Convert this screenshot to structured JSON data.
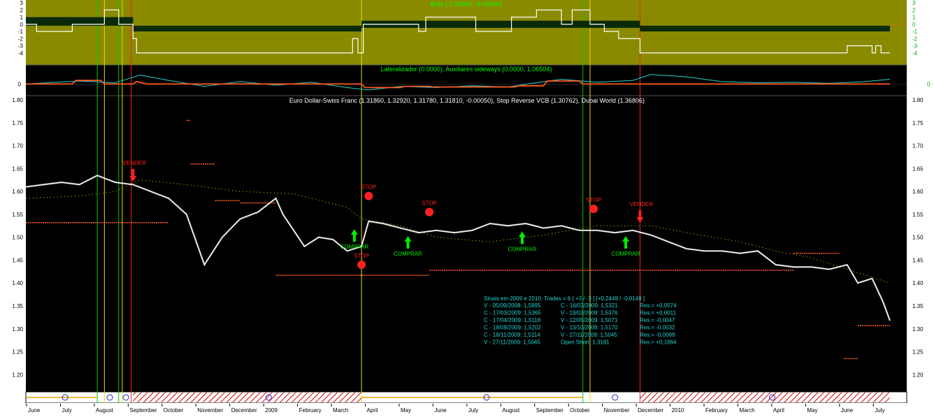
{
  "colors": {
    "indicator_bg": "#8a8a00",
    "panel_bg": "#000000",
    "price_line": "#ffffff",
    "stop_reverse": "#ff5a1f",
    "dubai_dots": "#e0e000",
    "buy_signal": "#00ee00",
    "sell_signal": "#ff2020",
    "stats_text": "#22d3d3",
    "title_green": "#00ff00",
    "axis_text": "#000000"
  },
  "chart_data": [
    {
      "type": "step",
      "title": "Bobi (-1.00000, -5.00000)",
      "ylim": [
        -5,
        3
      ],
      "yticks": [
        "3",
        "2",
        "1",
        "0",
        "-1",
        "-2",
        "-3",
        "-4"
      ],
      "series": [
        {
          "values": [
            {
              "t": 0,
              "v": 0
            },
            {
              "t": 0.3,
              "v": -1
            },
            {
              "t": 1.3,
              "v": 0
            },
            {
              "t": 2.0,
              "v": 0
            },
            {
              "t": 2.2,
              "v": 2
            },
            {
              "t": 2.6,
              "v": 0
            },
            {
              "t": 3.0,
              "v": -2
            },
            {
              "t": 3.1,
              "v": -4
            },
            {
              "t": 9.0,
              "v": -4
            },
            {
              "t": 9.15,
              "v": -2
            },
            {
              "t": 9.3,
              "v": -4
            },
            {
              "t": 9.45,
              "v": 0
            },
            {
              "t": 10.8,
              "v": 0
            },
            {
              "t": 11.0,
              "v": -1
            },
            {
              "t": 11.2,
              "v": 1
            },
            {
              "t": 12.5,
              "v": 1
            },
            {
              "t": 12.6,
              "v": -1
            },
            {
              "t": 13.4,
              "v": -1
            },
            {
              "t": 13.6,
              "v": 1
            },
            {
              "t": 14.3,
              "v": 2
            },
            {
              "t": 15.0,
              "v": 0
            },
            {
              "t": 15.3,
              "v": 2
            },
            {
              "t": 15.8,
              "v": 0
            },
            {
              "t": 16.2,
              "v": -1
            },
            {
              "t": 16.6,
              "v": -2
            },
            {
              "t": 17.0,
              "v": -2
            },
            {
              "t": 17.2,
              "v": -4
            },
            {
              "t": 22.8,
              "v": -4
            },
            {
              "t": 23.0,
              "v": -3
            },
            {
              "t": 23.6,
              "v": -3
            },
            {
              "t": 23.7,
              "v": -4
            },
            {
              "t": 23.8,
              "v": -3
            },
            {
              "t": 23.95,
              "v": -4
            },
            {
              "t": 24.2,
              "v": -4
            }
          ]
        }
      ],
      "band": [
        {
          "t0": 0.0,
          "t1": 3.0,
          "lo": -0.2,
          "hi": 1.0
        },
        {
          "t0": 3.0,
          "t1": 9.4,
          "lo": -1.0,
          "hi": -0.2
        },
        {
          "t0": 9.4,
          "t1": 17.2,
          "lo": -0.5,
          "hi": 0.5
        },
        {
          "t0": 17.2,
          "t1": 24.2,
          "lo": -1.0,
          "hi": -0.2
        }
      ]
    },
    {
      "type": "line",
      "title": "Lateralizador (0.0000), Auxiliares sideways (0.0000, 1.06504)",
      "ylim": [
        -1.5,
        2.5
      ],
      "yticks": [
        "0"
      ],
      "series": [
        {
          "color": "#22d3d3",
          "values": [
            [
              0,
              0
            ],
            [
              1.5,
              0.5
            ],
            [
              2.5,
              0.2
            ],
            [
              3.2,
              1.5
            ],
            [
              4,
              0.6
            ],
            [
              5,
              -0.4
            ],
            [
              6,
              0.4
            ],
            [
              7,
              -0.2
            ],
            [
              8,
              0.3
            ],
            [
              9,
              -0.6
            ],
            [
              9.6,
              -1.0
            ],
            [
              10.5,
              -0.4
            ],
            [
              11.5,
              -0.6
            ],
            [
              12.5,
              -0.3
            ],
            [
              13.5,
              -0.5
            ],
            [
              14.5,
              0.4
            ],
            [
              15.0,
              0.8
            ],
            [
              16,
              0.3
            ],
            [
              17,
              0.6
            ],
            [
              17.5,
              1.6
            ],
            [
              18.5,
              1.2
            ],
            [
              19.5,
              0.4
            ],
            [
              20.5,
              0.2
            ],
            [
              21.5,
              0.3
            ],
            [
              22.5,
              0.1
            ],
            [
              23.5,
              0.4
            ],
            [
              24.2,
              0.8
            ]
          ]
        },
        {
          "color": "#ff5a1f",
          "values": [
            [
              0,
              0
            ],
            [
              1.3,
              0
            ],
            [
              1.4,
              0.6
            ],
            [
              2.1,
              0.6
            ],
            [
              2.2,
              0
            ],
            [
              3.0,
              0
            ],
            [
              3.1,
              0.4
            ],
            [
              3.4,
              0
            ],
            [
              9.4,
              0
            ],
            [
              9.5,
              -0.6
            ],
            [
              10.5,
              -0.6
            ],
            [
              10.6,
              -0.4
            ],
            [
              11.3,
              -0.4
            ],
            [
              11.4,
              -0.5
            ],
            [
              13.7,
              -0.5
            ],
            [
              13.8,
              -0.3
            ],
            [
              14.5,
              -0.3
            ],
            [
              14.6,
              0.5
            ],
            [
              15.5,
              0.5
            ],
            [
              15.6,
              0
            ],
            [
              24.2,
              0
            ]
          ]
        }
      ]
    },
    {
      "type": "line",
      "title": "Euro Dollar-Swiss Franc (1.31860, 1.32920, 1.31780, 1.31810, -0.00050), Stop Reverse VCB (1.30762), Dubai World (1.36806)",
      "ylim": [
        1.17,
        1.8
      ],
      "yticks": [
        "1.80",
        "1.75",
        "1.70",
        "1.65",
        "1.60",
        "1.55",
        "1.50",
        "1.45",
        "1.40",
        "1.35",
        "1.30",
        "1.25",
        "1.20"
      ],
      "x_categories": [
        "June",
        "July",
        "August",
        "September",
        "October",
        "November",
        "December",
        "2009",
        "February",
        "March",
        "April",
        "May",
        "June",
        "July",
        "August",
        "September",
        "October",
        "November",
        "December",
        "2010",
        "February",
        "March",
        "April",
        "May",
        "June",
        "July"
      ],
      "series": [
        {
          "name": "Euro Dollar-Swiss Franc",
          "values": [
            [
              0,
              1.61
            ],
            [
              0.5,
              1.615
            ],
            [
              1.0,
              1.62
            ],
            [
              1.5,
              1.615
            ],
            [
              2.0,
              1.635
            ],
            [
              2.5,
              1.62
            ],
            [
              3.0,
              1.615
            ],
            [
              3.5,
              1.6
            ],
            [
              4.0,
              1.585
            ],
            [
              4.5,
              1.55
            ],
            [
              5.0,
              1.44
            ],
            [
              5.5,
              1.5
            ],
            [
              6.0,
              1.54
            ],
            [
              6.5,
              1.555
            ],
            [
              7.0,
              1.585
            ],
            [
              7.2,
              1.55
            ],
            [
              7.8,
              1.48
            ],
            [
              8.2,
              1.5
            ],
            [
              8.6,
              1.495
            ],
            [
              9.0,
              1.47
            ],
            [
              9.4,
              1.48
            ],
            [
              9.6,
              1.535
            ],
            [
              10.0,
              1.53
            ],
            [
              10.5,
              1.52
            ],
            [
              11.0,
              1.51
            ],
            [
              11.5,
              1.515
            ],
            [
              12.0,
              1.51
            ],
            [
              12.5,
              1.515
            ],
            [
              13.0,
              1.53
            ],
            [
              13.5,
              1.525
            ],
            [
              14.0,
              1.53
            ],
            [
              14.5,
              1.52
            ],
            [
              15.0,
              1.525
            ],
            [
              15.5,
              1.515
            ],
            [
              16.0,
              1.515
            ],
            [
              16.5,
              1.51
            ],
            [
              17.0,
              1.515
            ],
            [
              17.5,
              1.505
            ],
            [
              18.0,
              1.49
            ],
            [
              18.5,
              1.475
            ],
            [
              19.0,
              1.47
            ],
            [
              19.5,
              1.47
            ],
            [
              20.0,
              1.465
            ],
            [
              20.5,
              1.47
            ],
            [
              21.0,
              1.44
            ],
            [
              21.5,
              1.435
            ],
            [
              22.0,
              1.435
            ],
            [
              22.5,
              1.43
            ],
            [
              23.0,
              1.44
            ],
            [
              23.3,
              1.4
            ],
            [
              23.7,
              1.41
            ],
            [
              24.0,
              1.36
            ],
            [
              24.2,
              1.318
            ]
          ]
        },
        {
          "name": "Stop Reverse VCB",
          "segments": [
            {
              "t0": 0.0,
              "t1": 4.0,
              "v": 1.532
            },
            {
              "t0": 4.5,
              "t1": 4.6,
              "v": 1.755
            },
            {
              "t0": 4.6,
              "t1": 5.3,
              "v": 1.66
            },
            {
              "t0": 5.3,
              "t1": 6.0,
              "v": 1.58
            },
            {
              "t0": 6.0,
              "t1": 7.0,
              "v": 1.575
            },
            {
              "t0": 7.0,
              "t1": 11.3,
              "v": 1.417
            },
            {
              "t0": 11.3,
              "t1": 21.5,
              "v": 1.428
            },
            {
              "t0": 21.5,
              "t1": 22.8,
              "v": 1.465
            },
            {
              "t0": 22.9,
              "t1": 23.3,
              "v": 1.235
            },
            {
              "t0": 23.3,
              "t1": 24.2,
              "v": 1.307
            }
          ]
        },
        {
          "name": "Dubai World",
          "values": [
            [
              0,
              1.585
            ],
            [
              1.5,
              1.59
            ],
            [
              2.5,
              1.6
            ],
            [
              3.2,
              1.625
            ],
            [
              4.5,
              1.615
            ],
            [
              6.0,
              1.6
            ],
            [
              7.5,
              1.595
            ],
            [
              9.0,
              1.565
            ],
            [
              9.4,
              1.54
            ],
            [
              10.5,
              1.525
            ],
            [
              11.5,
              1.5
            ],
            [
              13.0,
              1.49
            ],
            [
              14.5,
              1.505
            ],
            [
              16.0,
              1.525
            ],
            [
              17.5,
              1.525
            ],
            [
              18.5,
              1.51
            ],
            [
              20.0,
              1.49
            ],
            [
              21.0,
              1.47
            ],
            [
              22.0,
              1.455
            ],
            [
              23.0,
              1.43
            ],
            [
              24.2,
              1.4
            ]
          ]
        }
      ],
      "vertical_lines": [
        {
          "t": 2.0,
          "color": "#00cc00"
        },
        {
          "t": 2.2,
          "color": "#e0e000"
        },
        {
          "t": 2.6,
          "color": "#00cc00"
        },
        {
          "t": 2.7,
          "color": "#e0e000"
        },
        {
          "t": 2.95,
          "color": "#ff2020"
        },
        {
          "t": 9.4,
          "color": "#e0e000"
        },
        {
          "t": 15.6,
          "color": "#00cc00"
        },
        {
          "t": 15.8,
          "color": "#e0e000"
        },
        {
          "t": 17.2,
          "color": "#ff2020"
        }
      ],
      "annotations": [
        {
          "text": "VENDER",
          "t": 3.0,
          "v": 1.655,
          "type": "sell"
        },
        {
          "text": "STOP",
          "t": 9.6,
          "v": 1.59,
          "type": "stop"
        },
        {
          "text": "COMPRAR",
          "t": 9.2,
          "v": 1.475,
          "type": "buy"
        },
        {
          "text": "STOP",
          "t": 9.4,
          "v": 1.44,
          "type": "stop"
        },
        {
          "text": "COMPRAR",
          "t": 10.7,
          "v": 1.46,
          "type": "buy"
        },
        {
          "text": "STOP",
          "t": 11.3,
          "v": 1.555,
          "type": "stop"
        },
        {
          "text": "COMPRAR",
          "t": 13.9,
          "v": 1.47,
          "type": "buy"
        },
        {
          "text": "STOP",
          "t": 15.9,
          "v": 1.562,
          "type": "stop"
        },
        {
          "text": "VENDER",
          "t": 17.2,
          "v": 1.565,
          "type": "sell"
        },
        {
          "text": "COMPRAR",
          "t": 16.8,
          "v": 1.46,
          "type": "buy"
        }
      ]
    }
  ],
  "stats": {
    "header": "Sinais em 2009 e 2010: Trades = 6 [ +3 / -3 ] [+0,2449 / -0,0148 ]",
    "rows": [
      [
        "V - 05/09/2008: 1,5895",
        "C - 16/03/2009: 1,5321",
        "Res.= +0,0574"
      ],
      [
        "C - 17/03/2009: 1,5365",
        "V - 19/03/2009: 1,5376",
        "Res.= +0,0011"
      ],
      [
        "C - 17/04/2009: 1,5118",
        "V - 12/05/2009: 1,5071",
        "Res.= -0,0047"
      ],
      [
        "C - 18/08/2009: 1,5202",
        "V - 13/10/2009: 1,5170",
        "Res.= -0,0032"
      ],
      [
        "C - 18/11/2009: 1,5114",
        "V - 27/11/2009: 1,5045",
        "Res.= -0,0069"
      ],
      [
        "V - 27/11/2009: 1,5045",
        "Open Short: 1,3181",
        "Res.= +0,1864"
      ]
    ]
  }
}
